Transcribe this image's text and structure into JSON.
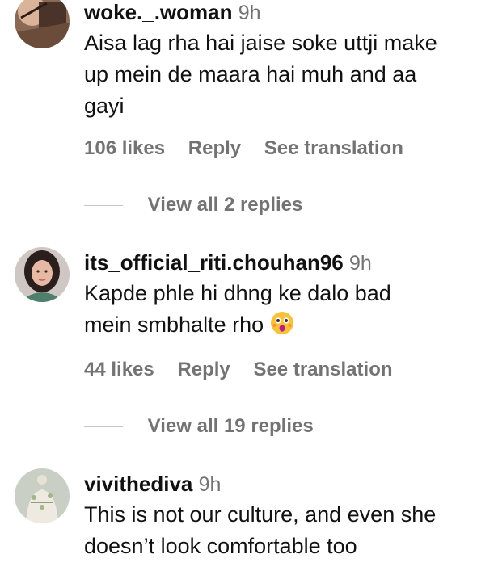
{
  "comments": [
    {
      "username": "woke._.woman",
      "time": "9h",
      "text": "Aisa lag rha hai jaise soke uttji make up mein de maara hai muh and aa gayi",
      "likes": "106 likes",
      "reply": "Reply",
      "translate": "See translation",
      "view_replies": "View all 2 replies"
    },
    {
      "username": "its_official_riti.chouhan96",
      "time": "9h",
      "text": "Kapde phle hi dhng ke dalo bad mein smbhalte rho",
      "emoji": "astonished-face-emoji",
      "likes": "44 likes",
      "reply": "Reply",
      "translate": "See translation",
      "view_replies": "View all 19 replies"
    },
    {
      "username": "vivithediva",
      "time": "9h",
      "text": "This is not our culture, and even she doesn’t look comfortable too"
    }
  ],
  "colors": {
    "meta_gray": "#737373",
    "text": "#111111",
    "divider": "#c7c7c7"
  }
}
